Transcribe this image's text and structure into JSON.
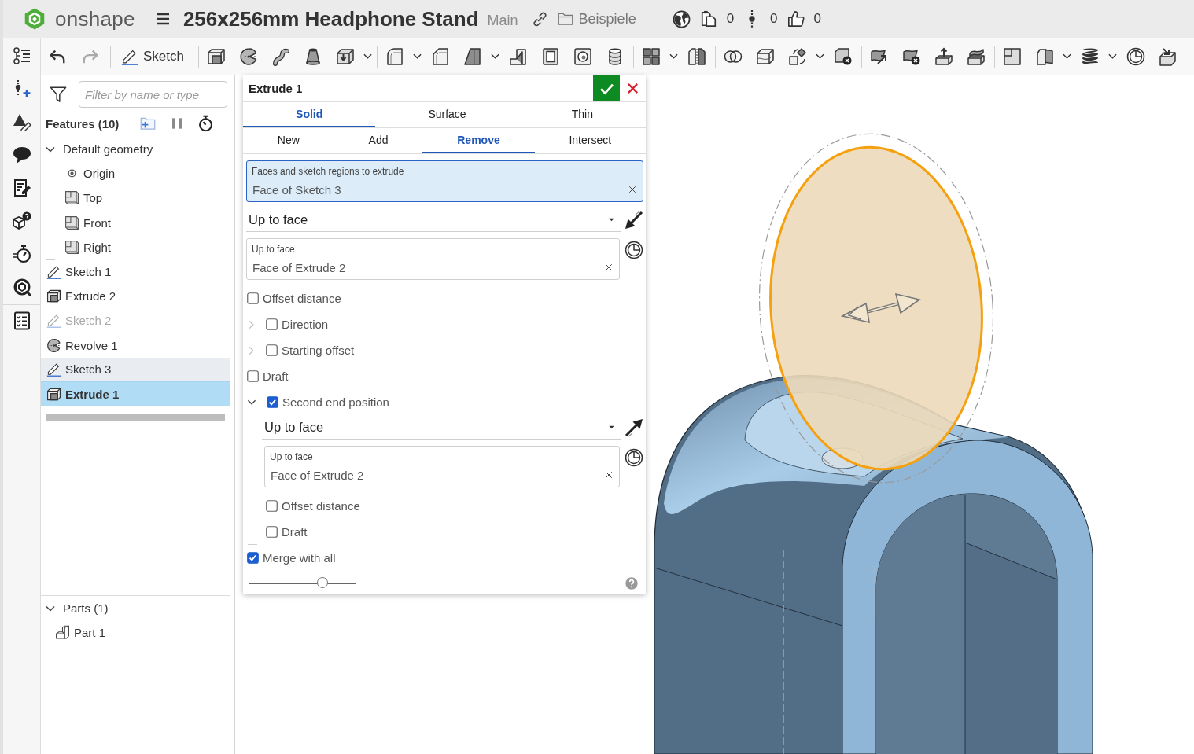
{
  "header": {
    "logo_text": "onshape",
    "title": "256x256mm Headphone Stand",
    "branch": "Main",
    "folder": "Beispiele",
    "counters": [
      {
        "kind": "copies",
        "value": "0"
      },
      {
        "kind": "versions",
        "value": "0"
      },
      {
        "kind": "likes",
        "value": "0"
      }
    ]
  },
  "toolbar": {
    "sketch_label": "Sketch"
  },
  "feature_panel": {
    "filter": {
      "placeholder": "Filter by name or type"
    },
    "title": "Features (10)",
    "tree": [
      {
        "label": "Default geometry",
        "kind": "group",
        "expanded": true,
        "selected": false,
        "highlighted": false,
        "inactive": false,
        "children": [
          {
            "label": "Origin",
            "kind": "origin",
            "selected": false
          },
          {
            "label": "Top",
            "kind": "plane",
            "selected": false
          },
          {
            "label": "Front",
            "kind": "plane",
            "selected": false
          },
          {
            "label": "Right",
            "kind": "plane",
            "selected": false
          }
        ]
      },
      {
        "label": "Sketch 1",
        "kind": "sketch",
        "selected": false,
        "highlighted": false,
        "inactive": false
      },
      {
        "label": "Extrude 2",
        "kind": "extrude",
        "selected": false,
        "highlighted": false,
        "inactive": false
      },
      {
        "label": "Sketch 2",
        "kind": "sketch",
        "selected": false,
        "highlighted": false,
        "inactive": true
      },
      {
        "label": "Revolve 1",
        "kind": "revolve",
        "selected": false,
        "highlighted": false,
        "inactive": false
      },
      {
        "label": "Sketch 3",
        "kind": "sketch",
        "selected": false,
        "highlighted": true,
        "inactive": false
      },
      {
        "label": "Extrude 1",
        "kind": "extrude",
        "selected": true,
        "highlighted": false,
        "inactive": false
      }
    ],
    "parts": {
      "title": "Parts (1)",
      "expanded": true,
      "items": [
        {
          "label": "Part 1",
          "selected": false
        }
      ]
    }
  },
  "dialog": {
    "title": "Extrude 1",
    "type_tabs": [
      {
        "label": "Solid",
        "selected": true
      },
      {
        "label": "Surface",
        "selected": false
      },
      {
        "label": "Thin",
        "selected": false
      }
    ],
    "operation_tabs": [
      {
        "label": "New",
        "selected": false
      },
      {
        "label": "Add",
        "selected": false
      },
      {
        "label": "Remove",
        "selected": true
      },
      {
        "label": "Intersect",
        "selected": false
      }
    ],
    "selection_field": {
      "label": "Faces and sketch regions to extrude",
      "value": "Face of Sketch 3",
      "active": true
    },
    "end_condition": {
      "value": "Up to face"
    },
    "end_face_field": {
      "label": "Up to face",
      "value": "Face of Extrude 2",
      "active": false
    },
    "options": [
      {
        "kind": "checkbox",
        "label": "Offset distance",
        "checked": false
      },
      {
        "kind": "collapsible",
        "label": "Direction",
        "checked": false,
        "expanded": false
      },
      {
        "kind": "collapsible",
        "label": "Starting offset",
        "checked": false,
        "expanded": false
      },
      {
        "kind": "checkbox",
        "label": "Draft",
        "checked": false
      },
      {
        "kind": "collapsible",
        "label": "Second end position",
        "checked": true,
        "expanded": true,
        "section": {
          "end_condition": {
            "value": "Up to face"
          },
          "end_face_field": {
            "label": "Up to face",
            "value": "Face of Extrude 2",
            "active": false
          },
          "options": [
            {
              "kind": "checkbox",
              "label": "Offset distance",
              "checked": false
            },
            {
              "kind": "checkbox",
              "label": "Draft",
              "checked": false
            }
          ]
        }
      },
      {
        "kind": "checkbox",
        "label": "Merge with all",
        "checked": true
      }
    ],
    "slider": {
      "level": 0.69
    }
  }
}
